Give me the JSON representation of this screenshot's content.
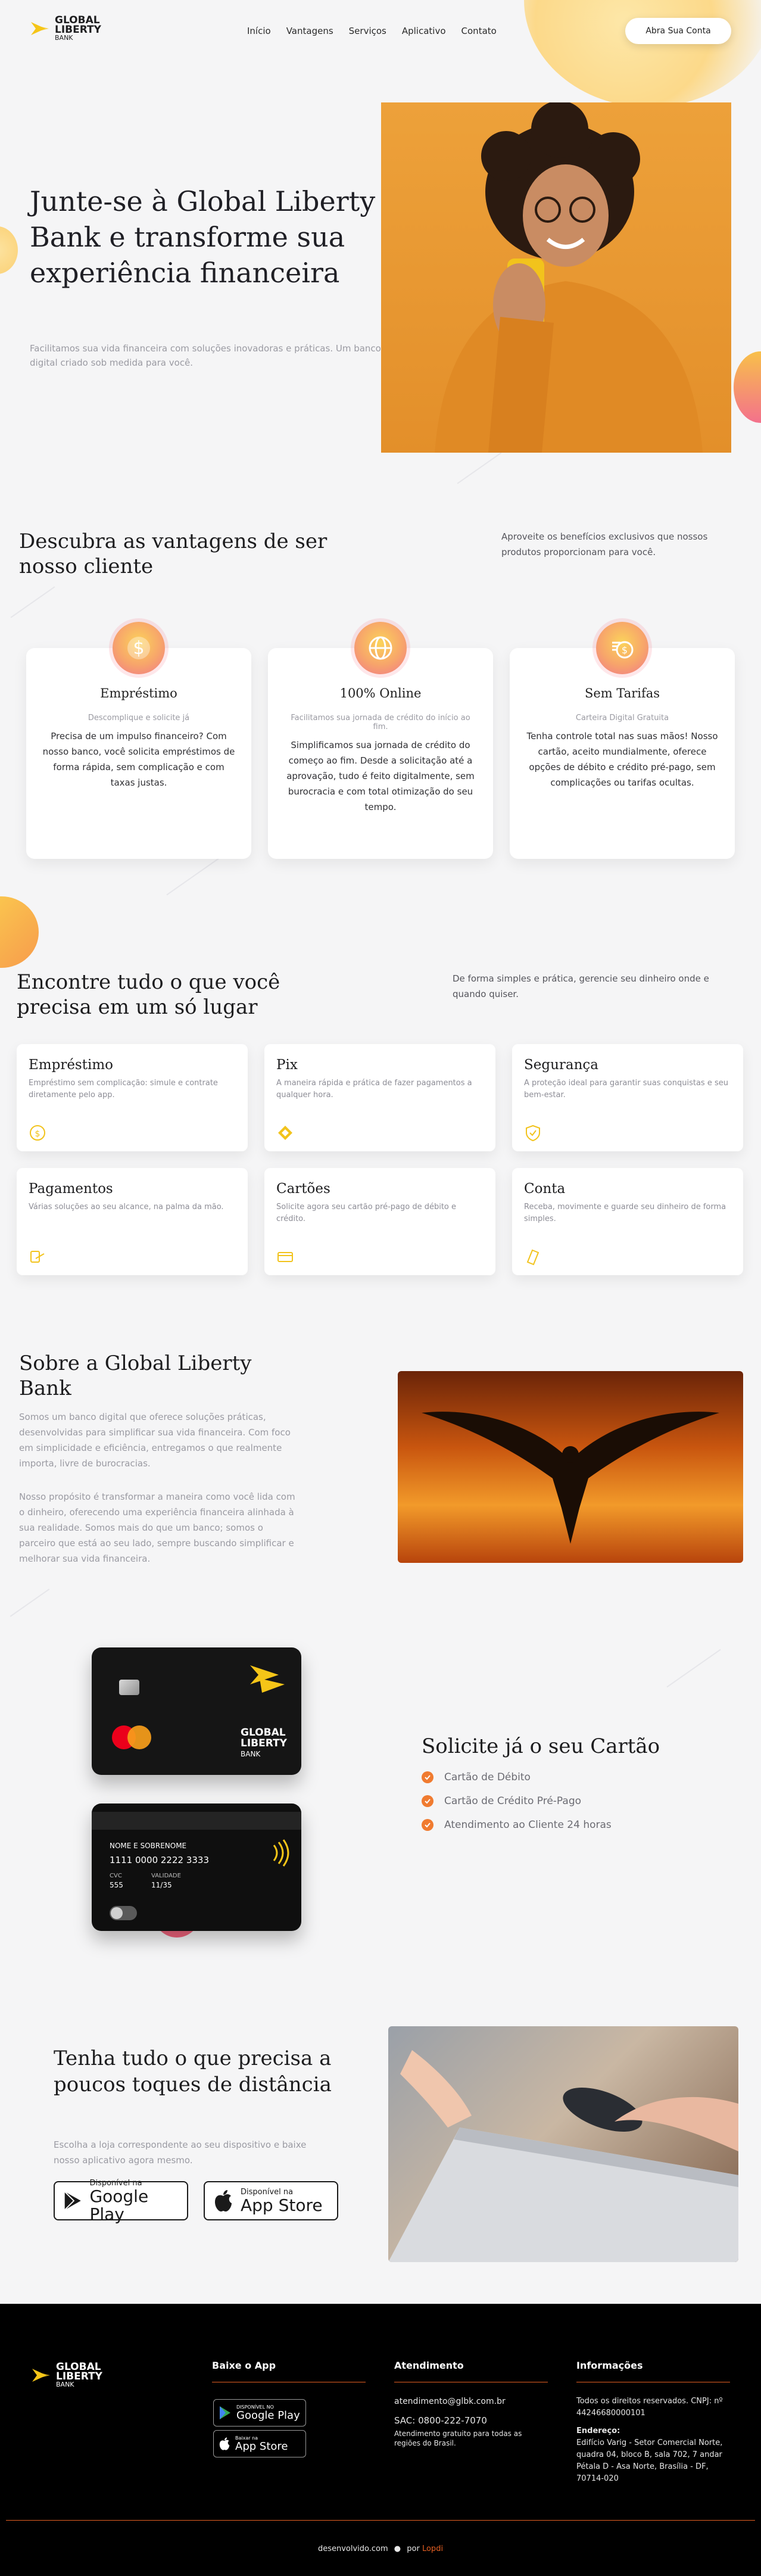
{
  "brand": {
    "line1": "GLOBAL",
    "line2": "LIBERTY",
    "line3": "BANK",
    "accent": "#f5c518"
  },
  "nav": {
    "items": [
      "Início",
      "Vantagens",
      "Serviços",
      "Aplicativo",
      "Contato"
    ],
    "cta": "Abra Sua Conta"
  },
  "hero": {
    "title": "Junte-se à Global Liberty Bank e transforme sua experiência financeira",
    "subtitle": "Facilitamos sua vida financeira com soluções inovadoras e práticas. Um banco digital criado sob medida para você."
  },
  "benefits": {
    "title": "Descubra as vantagens de ser nosso cliente",
    "aside": "Aproveite os benefícios exclusivos que nossos produtos proporcionam para você.",
    "cards": [
      {
        "title": "Empréstimo",
        "sub": "Descomplique e solicite já",
        "text": "Precisa de um impulso financeiro? Com nosso banco, você solicita empréstimos de forma rápida, sem complicação e com taxas justas.",
        "icon": "dollar-icon"
      },
      {
        "title": "100% Online",
        "sub": "Facilitamos sua jornada de crédito do início ao fim.",
        "text": "Simplificamos sua jornada de crédito do começo ao fim. Desde a solicitação até a aprovação, tudo é feito digitalmente, sem burocracia e com total otimização do seu tempo.",
        "icon": "globe-icon"
      },
      {
        "title": "Sem Tarifas",
        "sub": "Carteira Digital Gratuita",
        "text": "Tenha controle total nas suas mãos! Nosso cartão, aceito mundialmente, oferece opções de débito e crédito pré-pago, sem complicações ou tarifas ocultas.",
        "icon": "coins-icon"
      }
    ]
  },
  "services": {
    "title": "Encontre tudo o que você precisa em um só lugar",
    "aside": "De forma simples e prática, gerencie seu dinheiro onde e quando quiser.",
    "cards": [
      {
        "title": "Empréstimo",
        "text": "Empréstimo sem complicação: simule e contrate diretamente pelo app.",
        "icon": "loan-icon"
      },
      {
        "title": "Pix",
        "text": "A maneira rápida e prática de fazer pagamentos a qualquer hora.",
        "icon": "pix-icon"
      },
      {
        "title": "Segurança",
        "text": "A proteção ideal para garantir suas conquistas e seu bem-estar.",
        "icon": "shield-icon"
      },
      {
        "title": "Pagamentos",
        "text": "Várias soluções ao seu alcance, na palma da mão.",
        "icon": "payments-icon"
      },
      {
        "title": "Cartões",
        "text": "Solicite agora seu cartão pré-pago de débito e crédito.",
        "icon": "card-icon"
      },
      {
        "title": "Conta",
        "text": "Receba, movimente e guarde seu dinheiro de forma simples.",
        "icon": "account-icon"
      }
    ]
  },
  "about": {
    "title": "Sobre a Global Liberty Bank",
    "p1": "Somos um banco digital que oferece soluções práticas, desenvolvidas para simplificar sua vida financeira. Com foco em simplicidade e eficiência, entregamos o que realmente importa, livre de burocracias.",
    "p2": "Nosso propósito é transformar a maneira como você lida com o dinheiro, oferecendo uma experiência financeira alinhada à sua realidade. Somos mais do que um banco; somos o parceiro que está ao seu lado, sempre buscando simplificar e melhorar sua vida financeira."
  },
  "card_section": {
    "title": "Solicite já o seu Cartão",
    "items": [
      "Cartão de Débito",
      "Cartão de Crédito Pré-Pago",
      "Atendimento ao Cliente 24 horas"
    ],
    "card_back": {
      "holder": "NOME E SOBRENOME",
      "number": "1111 0000 2222 3333",
      "cvc_label": "CVC",
      "cvc": "555",
      "valid_label": "VALIDADE",
      "valid": "11/35"
    }
  },
  "app": {
    "title": "Tenha tudo o que precisa a poucos toques de distância",
    "subtitle": "Escolha a loja correspondente ao seu dispositivo e baixe nosso aplicativo agora mesmo.",
    "google_small": "Disponível na",
    "google_big": "Google Play",
    "apple_small": "Disponível na",
    "apple_big": "App Store"
  },
  "footer": {
    "app_title": "Baixe o App",
    "google_small": "DISPONÍVEL NO",
    "google_big": "Google Play",
    "apple_small": "Baixar na",
    "apple_big": "App Store",
    "support_title": "Atendimento",
    "email": "atendimento@glbk.com.br",
    "sac": "SAC: 0800-222-7070",
    "sac_note": "Atendimento gratuito para todas as regiões do Brasil.",
    "info_title": "Informações",
    "rights": "Todos os direitos reservados. CNPJ: nº 44246680000101",
    "address_label": "Endereço:",
    "address": "Edifício Varig - Setor Comercial Norte, quadra 04, bloco B, sala 702, 7 andar Pétala D - Asa Norte, Brasília - DF, 70714-020",
    "dev_prefix": "desenvolvido.com",
    "dev_by": "por",
    "dev_name": "Lopdi"
  }
}
